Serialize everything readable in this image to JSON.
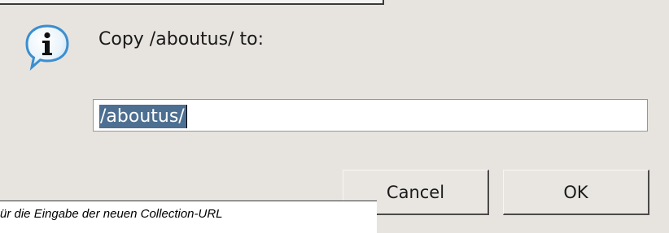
{
  "dialog": {
    "message": "Copy /aboutus/ to:",
    "icon": "info-icon",
    "input_value": "/aboutus/",
    "cancel_label": "Cancel",
    "ok_label": "OK",
    "accent_color": "#4d6f91"
  },
  "caption": {
    "text": "ür die Eingabe der neuen Collection-URL"
  }
}
